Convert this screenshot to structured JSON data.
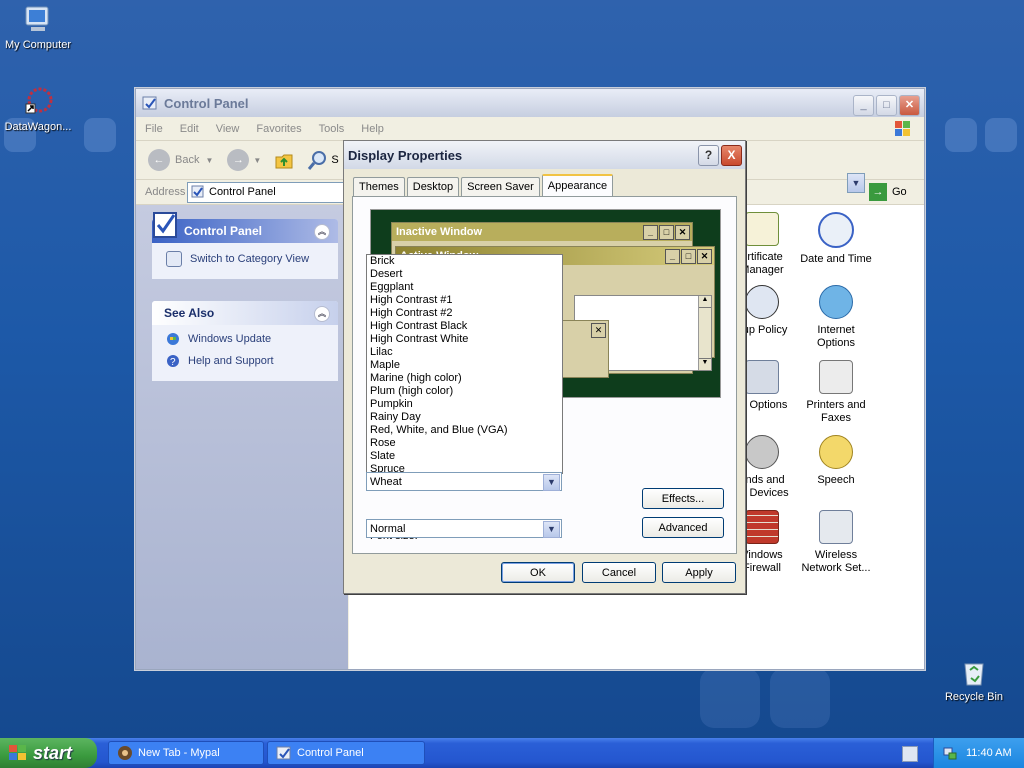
{
  "desktop": {
    "icons": [
      {
        "label": "My Computer"
      },
      {
        "label": "DataWagon..."
      },
      {
        "label": "Recycle Bin"
      }
    ]
  },
  "control_panel": {
    "title": "Control Panel",
    "menu": [
      "File",
      "Edit",
      "View",
      "Favorites",
      "Tools",
      "Help"
    ],
    "toolbar": {
      "back_label": "Back",
      "search_letter": "S"
    },
    "address": {
      "label": "Address",
      "value": "Control Panel",
      "go_label": "Go"
    },
    "sidebar": {
      "panel_title": "Control Panel",
      "switch_link": "Switch to Category View",
      "see_also_title": "See Also",
      "see_also_links": [
        "Windows Update",
        "Help and Support"
      ]
    },
    "items": [
      {
        "label": "ertificate\nManager"
      },
      {
        "label": "Date and Time"
      },
      {
        "label": "oup Policy"
      },
      {
        "label": "Internet\nOptions"
      },
      {
        "label": "er Options"
      },
      {
        "label": "Printers and\nFaxes"
      },
      {
        "label": "unds and\nlio Devices"
      },
      {
        "label": "Speech"
      },
      {
        "label": "Vindows\nFirewall"
      },
      {
        "label": "Wireless\nNetwork Set..."
      }
    ]
  },
  "dialog": {
    "title": "Display Properties",
    "tabs": [
      "Themes",
      "Desktop",
      "Screen Saver",
      "Appearance"
    ],
    "active_tab": "Appearance",
    "preview": {
      "inactive_title": "Inactive Window",
      "active_title": "Active Window"
    },
    "scheme_options": [
      "Brick",
      "Desert",
      "Eggplant",
      "High Contrast #1",
      "High Contrast #2",
      "High Contrast Black",
      "High Contrast White",
      "Lilac",
      "Maple",
      "Marine (high color)",
      "Plum (high color)",
      "Pumpkin",
      "Rainy Day",
      "Red, White, and Blue (VGA)",
      "Rose",
      "Slate",
      "Spruce"
    ],
    "scheme_selected": "Wheat",
    "font_size_label": "Font size:",
    "font_size_value": "Normal",
    "effects_label": "Effects...",
    "advanced_label": "Advanced",
    "ok_label": "OK",
    "cancel_label": "Cancel",
    "apply_label": "Apply",
    "help_glyph": "?",
    "close_glyph": "X"
  },
  "taskbar": {
    "start_label": "start",
    "buttons": [
      {
        "label": "New Tab - Mypal"
      },
      {
        "label": "Control Panel"
      }
    ],
    "clock": "11:40 AM"
  },
  "colors": {
    "xp_blue": "#2456cf",
    "start_green": "#3a9a3e",
    "preview_bg": "#0e3d1c",
    "wheat_title": "#b8ae5c"
  }
}
